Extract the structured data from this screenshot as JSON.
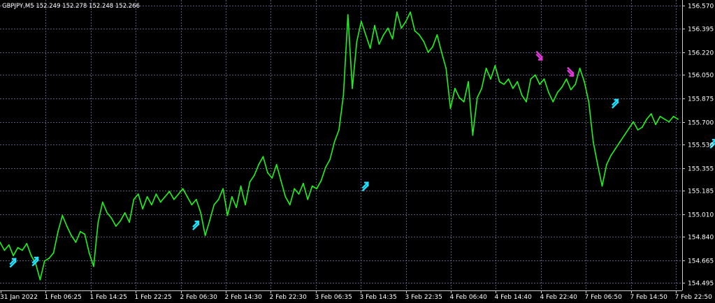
{
  "window": {
    "symbol_header": "GBPJPY,M5  152.249 152.278 152.248 152.266"
  },
  "colors": {
    "background": "#000000",
    "price_line": "#1cf51c",
    "grid": "#5a5a7a",
    "axis_text": "#ffffff",
    "buy_arrow": "#1ee3ff",
    "sell_arrow": "#e03ad8"
  },
  "chart_data": {
    "type": "line",
    "ylim": [
      154.44,
      156.6
    ],
    "y_ticks": [
      "156.570",
      "156.395",
      "156.220",
      "156.050",
      "155.875",
      "155.700",
      "155.530",
      "155.355",
      "155.185",
      "155.010",
      "154.840",
      "154.665",
      "154.495"
    ],
    "x_ticks": [
      "31 Jan 2022",
      "1 Feb 06:25",
      "1 Feb 14:25",
      "1 Feb 22:25",
      "2 Feb 06:30",
      "2 Feb 14:30",
      "2 Feb 22:30",
      "3 Feb 06:35",
      "3 Feb 14:35",
      "3 Feb 22:35",
      "4 Feb 06:40",
      "4 Feb 14:40",
      "4 Feb 22:40",
      "7 Feb 06:50",
      "7 Feb 14:50",
      "7 Feb 22:50"
    ],
    "series": [
      {
        "values": [
          154.8,
          154.74,
          154.78,
          154.7,
          154.76,
          154.74,
          154.79,
          154.7,
          154.64,
          154.52,
          154.66,
          154.68,
          154.72,
          154.88,
          155.0,
          154.92,
          154.85,
          154.8,
          154.88,
          154.86,
          154.72,
          154.62,
          154.95,
          155.1,
          155.02,
          154.98,
          154.92,
          154.96,
          155.02,
          154.95,
          155.12,
          155.16,
          155.05,
          155.14,
          155.08,
          155.16,
          155.1,
          155.14,
          155.18,
          155.12,
          155.16,
          155.2,
          155.14,
          155.08,
          155.12,
          155.02,
          154.85,
          154.96,
          155.08,
          155.12,
          155.2,
          155.0,
          155.14,
          155.06,
          155.22,
          155.08,
          155.25,
          155.3,
          155.38,
          155.44,
          155.32,
          155.28,
          155.38,
          155.26,
          155.14,
          155.08,
          155.2,
          155.16,
          155.24,
          155.12,
          155.22,
          155.2,
          155.26,
          155.36,
          155.42,
          155.55,
          155.64,
          155.9,
          156.5,
          155.95,
          156.3,
          156.45,
          156.35,
          156.25,
          156.42,
          156.28,
          156.35,
          156.4,
          156.32,
          156.52,
          156.4,
          156.45,
          156.52,
          156.38,
          156.35,
          156.3,
          156.22,
          156.26,
          156.35,
          156.22,
          156.1,
          155.8,
          155.95,
          155.88,
          155.85,
          156.0,
          155.6,
          155.88,
          155.95,
          156.1,
          156.02,
          156.12,
          156.0,
          155.98,
          156.02,
          155.95,
          156.0,
          155.9,
          155.85,
          156.02,
          156.05,
          155.98,
          156.02,
          155.92,
          155.85,
          155.92,
          155.96,
          156.02,
          155.94,
          155.98,
          156.1,
          156.0,
          155.85,
          155.55,
          155.38,
          155.22,
          155.38,
          155.45,
          155.5,
          155.55,
          155.6,
          155.65,
          155.7,
          155.64,
          155.66,
          155.72,
          155.76,
          155.68,
          155.74,
          155.72,
          155.7,
          155.74,
          155.72
        ]
      }
    ],
    "signals": [
      {
        "type": "buy",
        "index": 3,
        "value": 154.66
      },
      {
        "type": "buy",
        "index": 8,
        "value": 154.67
      },
      {
        "type": "buy",
        "index": 44,
        "value": 154.94
      },
      {
        "type": "buy",
        "index": 82,
        "value": 155.23
      },
      {
        "type": "sell",
        "index": 121,
        "value": 156.18
      },
      {
        "type": "sell",
        "index": 128,
        "value": 156.06
      },
      {
        "type": "buy",
        "index": 138,
        "value": 155.85
      },
      {
        "type": "buy",
        "index": 160,
        "value": 155.55
      }
    ]
  }
}
